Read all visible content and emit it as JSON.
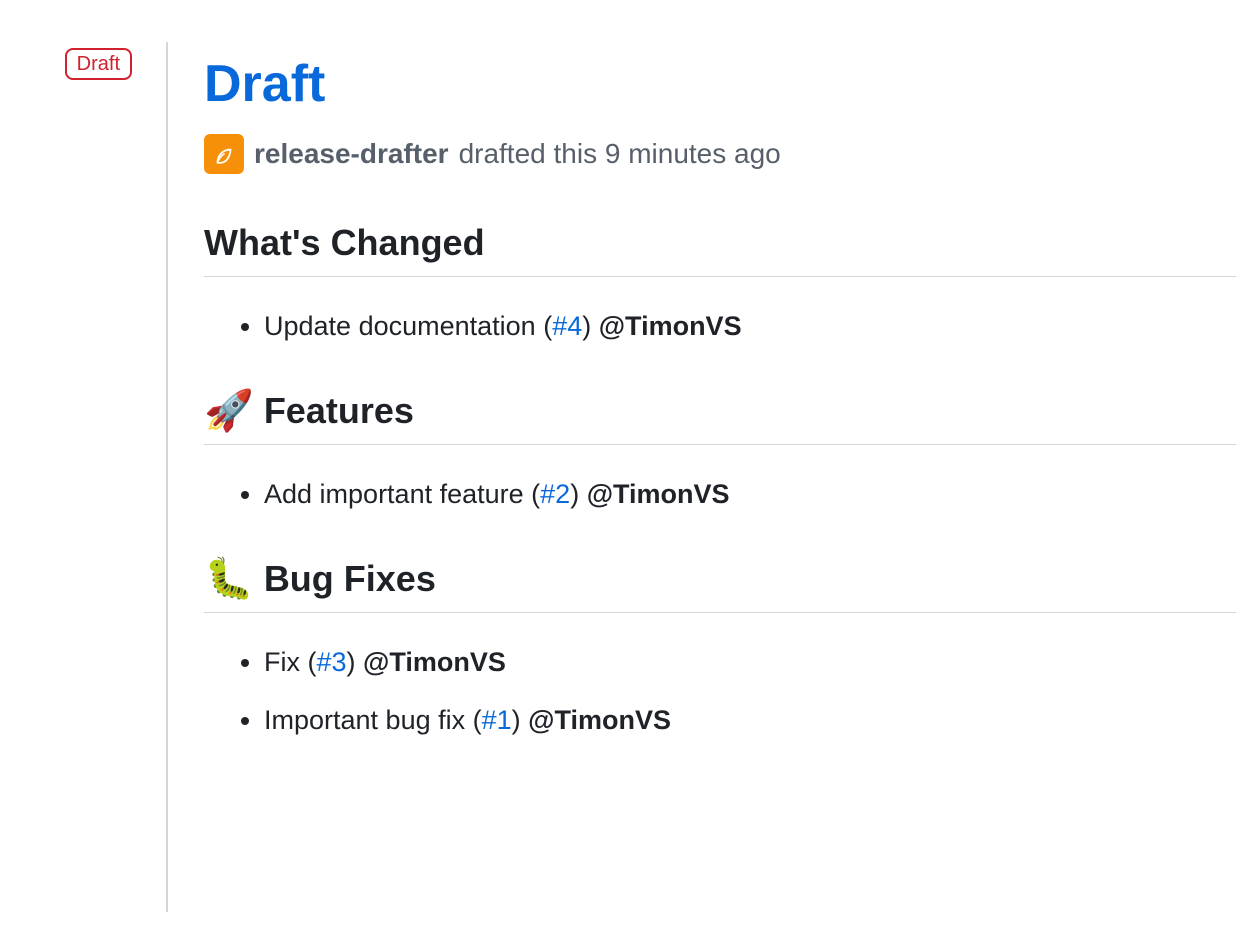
{
  "sidebar": {
    "badge_label": "Draft"
  },
  "release": {
    "title": "Draft",
    "author": "release-drafter",
    "meta_text": "drafted this 9 minutes ago"
  },
  "sections": [
    {
      "emoji": "",
      "heading": "What's Changed",
      "items": [
        {
          "text_before": "Update documentation (",
          "pr": "#4",
          "text_after": ") ",
          "mention": "@TimonVS"
        }
      ]
    },
    {
      "emoji": "🚀",
      "heading": "Features",
      "items": [
        {
          "text_before": "Add important feature (",
          "pr": "#2",
          "text_after": ") ",
          "mention": "@TimonVS"
        }
      ]
    },
    {
      "emoji": "🐛",
      "heading": "Bug Fixes",
      "items": [
        {
          "text_before": "Fix (",
          "pr": "#3",
          "text_after": ") ",
          "mention": "@TimonVS"
        },
        {
          "text_before": "Important bug fix (",
          "pr": "#1",
          "text_after": ") ",
          "mention": "@TimonVS"
        }
      ]
    }
  ]
}
